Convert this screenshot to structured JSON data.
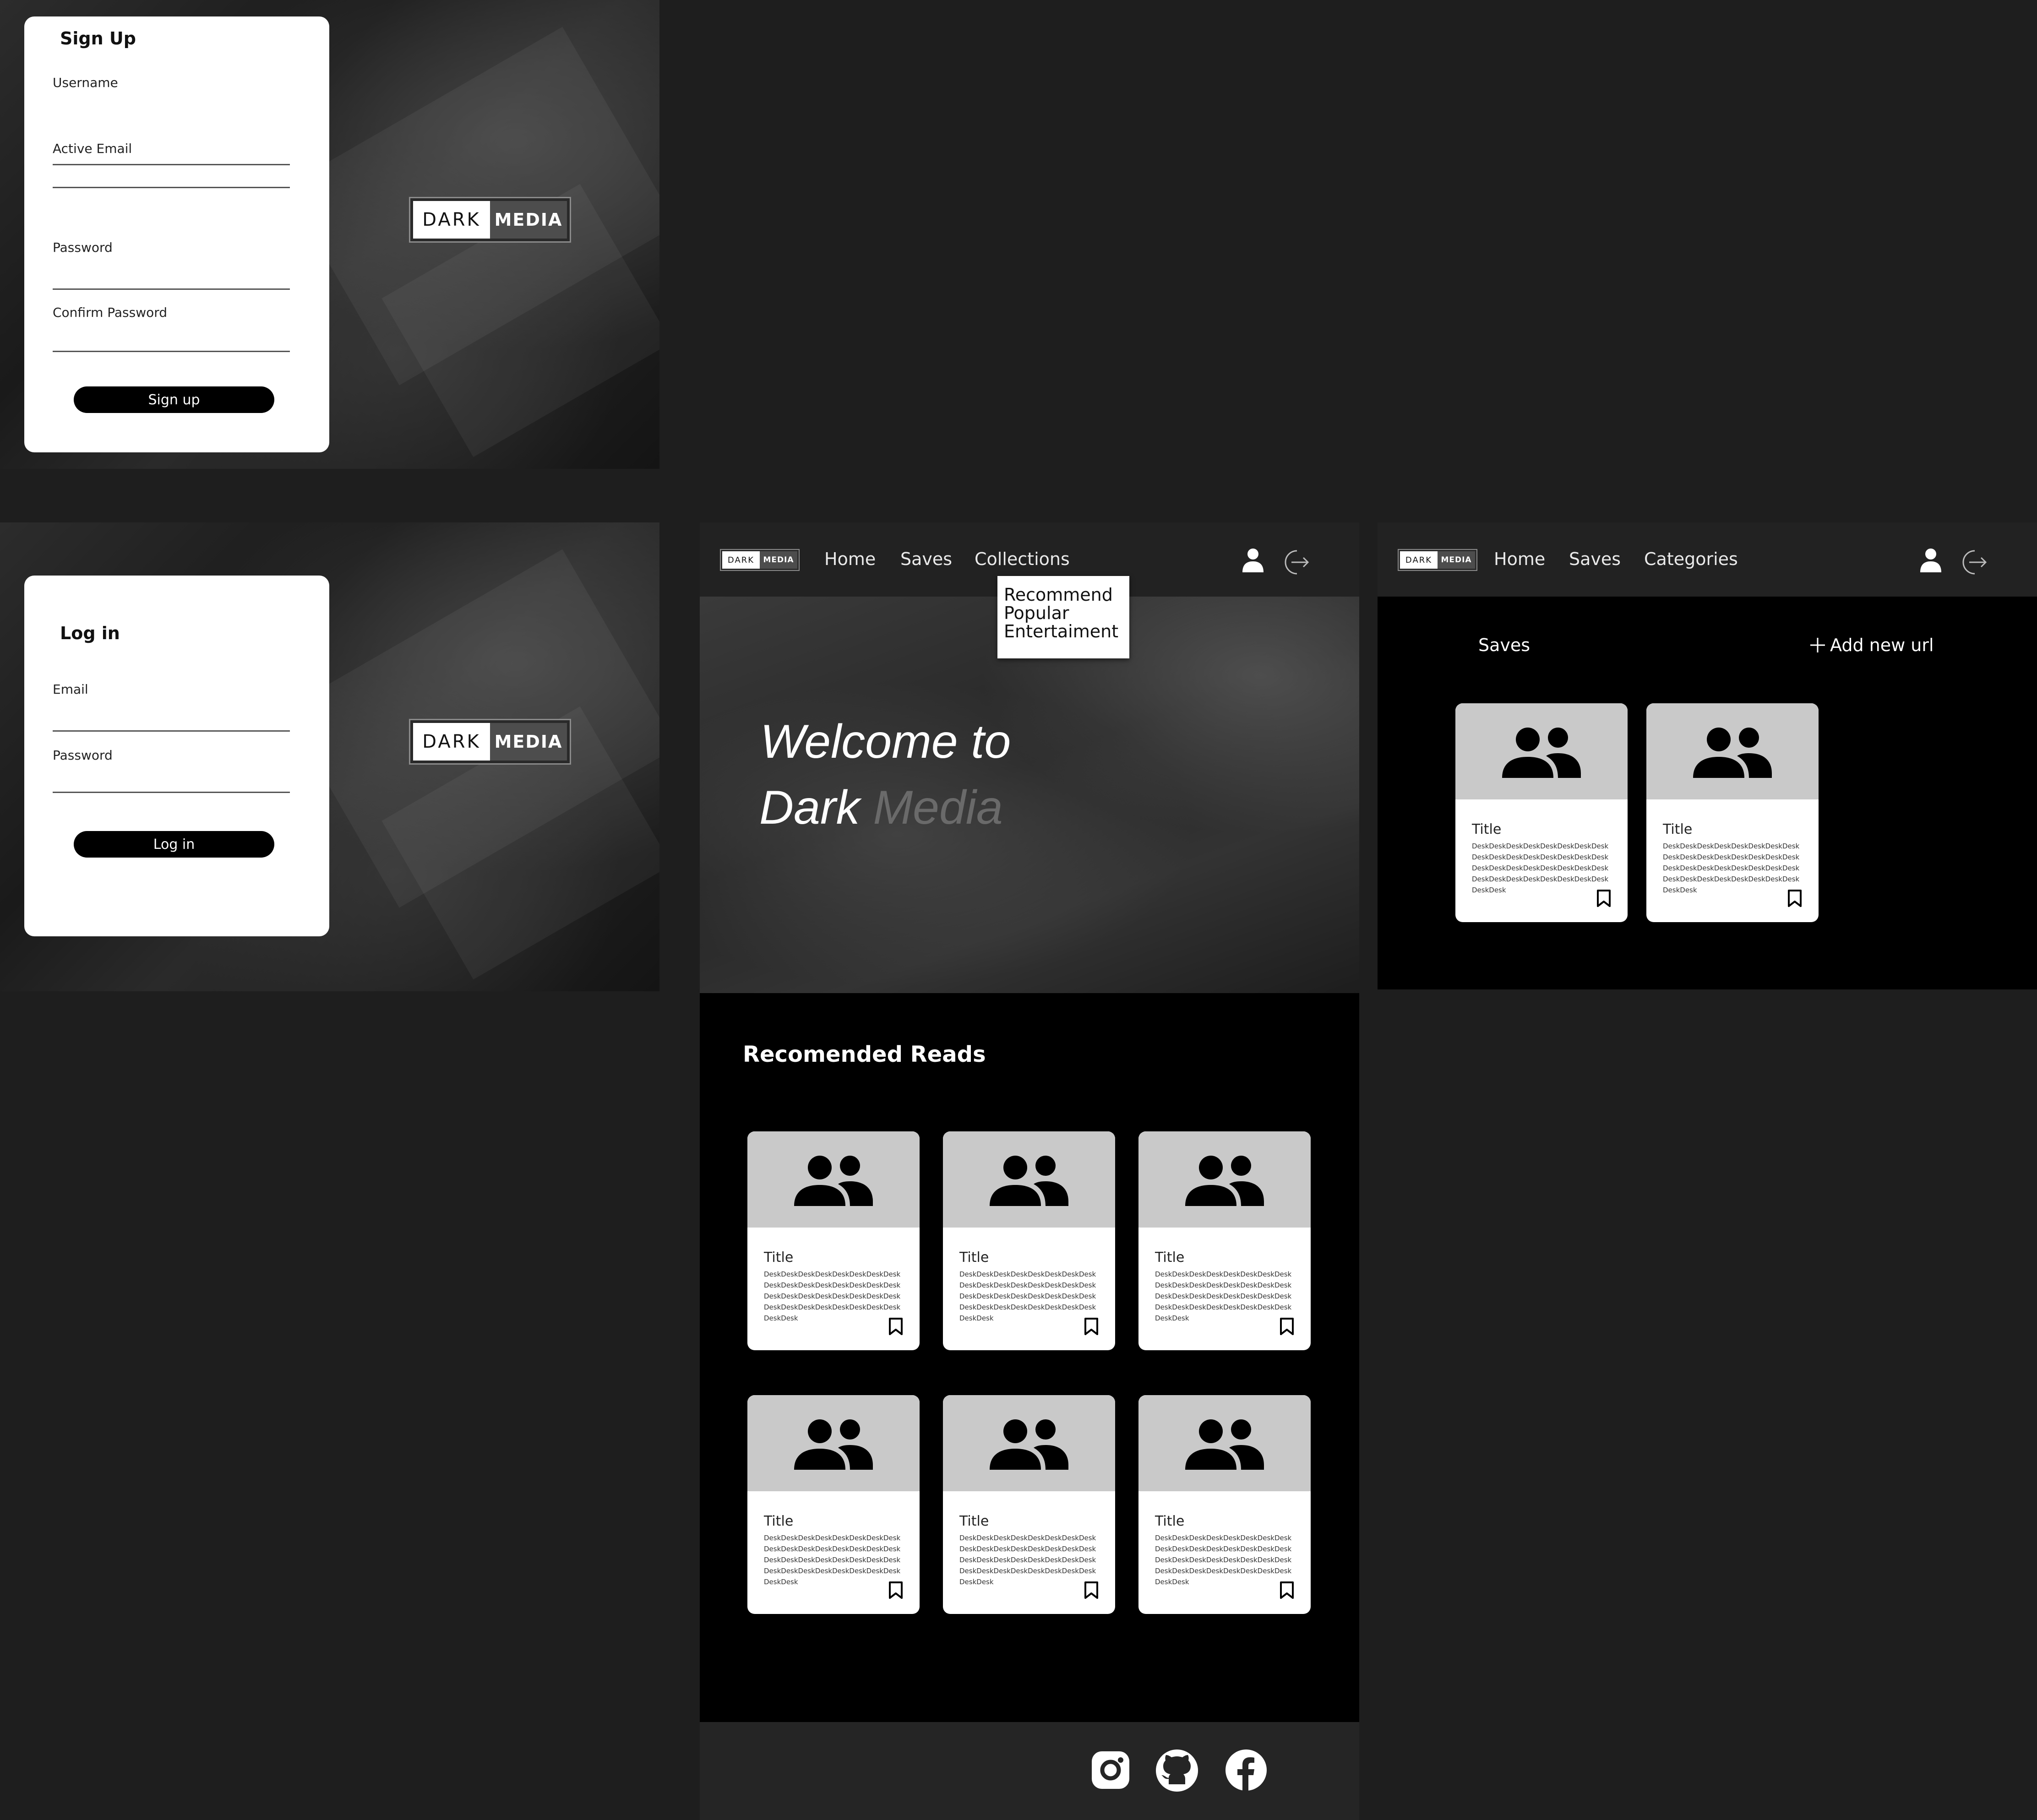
{
  "brand": {
    "part1": "DARK",
    "part2": "MEDIA"
  },
  "signup": {
    "title": "Sign Up",
    "username_label": "Username",
    "email_label": "Active Email",
    "password_label": "Password",
    "confirm_label": "Confirm Password",
    "button": "Sign up"
  },
  "login": {
    "title": "Log in",
    "email_label": "Email",
    "password_label": "Password",
    "button": "Log in"
  },
  "home": {
    "nav": {
      "home": "Home",
      "saves": "Saves",
      "collections": "Collections"
    },
    "dropdown": [
      "Recommend",
      "Popular",
      "Entertaiment"
    ],
    "hero": {
      "line1": "Welcome to",
      "line2a": "Dark",
      "line2b": "Media"
    },
    "section_title": "Recomended Reads",
    "cards": [
      {
        "title": "Title",
        "desc": "DeskDeskDeskDeskDeskDeskDeskDeskDeskDeskDeskDeskDeskDeskDeskDeskDeskDeskDeskDeskDeskDeskDeskDeskDeskDeskDeskDeskDeskDeskDeskDeskDeskDesk"
      },
      {
        "title": "Title",
        "desc": "DeskDeskDeskDeskDeskDeskDeskDeskDeskDeskDeskDeskDeskDeskDeskDeskDeskDeskDeskDeskDeskDeskDeskDeskDeskDeskDeskDeskDeskDeskDeskDeskDeskDesk"
      },
      {
        "title": "Title",
        "desc": "DeskDeskDeskDeskDeskDeskDeskDeskDeskDeskDeskDeskDeskDeskDeskDeskDeskDeskDeskDeskDeskDeskDeskDeskDeskDeskDeskDeskDeskDeskDeskDeskDeskDesk"
      },
      {
        "title": "Title",
        "desc": "DeskDeskDeskDeskDeskDeskDeskDeskDeskDeskDeskDeskDeskDeskDeskDeskDeskDeskDeskDeskDeskDeskDeskDeskDeskDeskDeskDeskDeskDeskDeskDeskDeskDesk"
      },
      {
        "title": "Title",
        "desc": "DeskDeskDeskDeskDeskDeskDeskDeskDeskDeskDeskDeskDeskDeskDeskDeskDeskDeskDeskDeskDeskDeskDeskDeskDeskDeskDeskDeskDeskDeskDeskDeskDeskDesk"
      },
      {
        "title": "Title",
        "desc": "DeskDeskDeskDeskDeskDeskDeskDeskDeskDeskDeskDeskDeskDeskDeskDeskDeskDeskDeskDeskDeskDeskDeskDeskDeskDeskDeskDeskDeskDeskDeskDeskDeskDesk"
      }
    ],
    "footer_icons": [
      "instagram-icon",
      "github-icon",
      "facebook-icon"
    ]
  },
  "saves": {
    "nav": {
      "home": "Home",
      "saves": "Saves",
      "categories": "Categories"
    },
    "heading": "Saves",
    "add_url": "Add new url",
    "cards": [
      {
        "title": "Title",
        "desc": "DeskDeskDeskDeskDeskDeskDeskDeskDeskDeskDeskDeskDeskDeskDeskDeskDeskDeskDeskDeskDeskDeskDeskDeskDeskDeskDeskDeskDeskDeskDeskDeskDeskDesk"
      },
      {
        "title": "Title",
        "desc": "DeskDeskDeskDeskDeskDeskDeskDeskDeskDeskDeskDeskDeskDeskDeskDeskDeskDeskDeskDeskDeskDeskDeskDeskDeskDeskDeskDeskDeskDeskDeskDeskDeskDesk"
      }
    ]
  },
  "colors": {
    "canvas": "#1e1e1e",
    "navbar": "#222222",
    "panel": "#000000",
    "thumb": "#c9c9c9"
  }
}
